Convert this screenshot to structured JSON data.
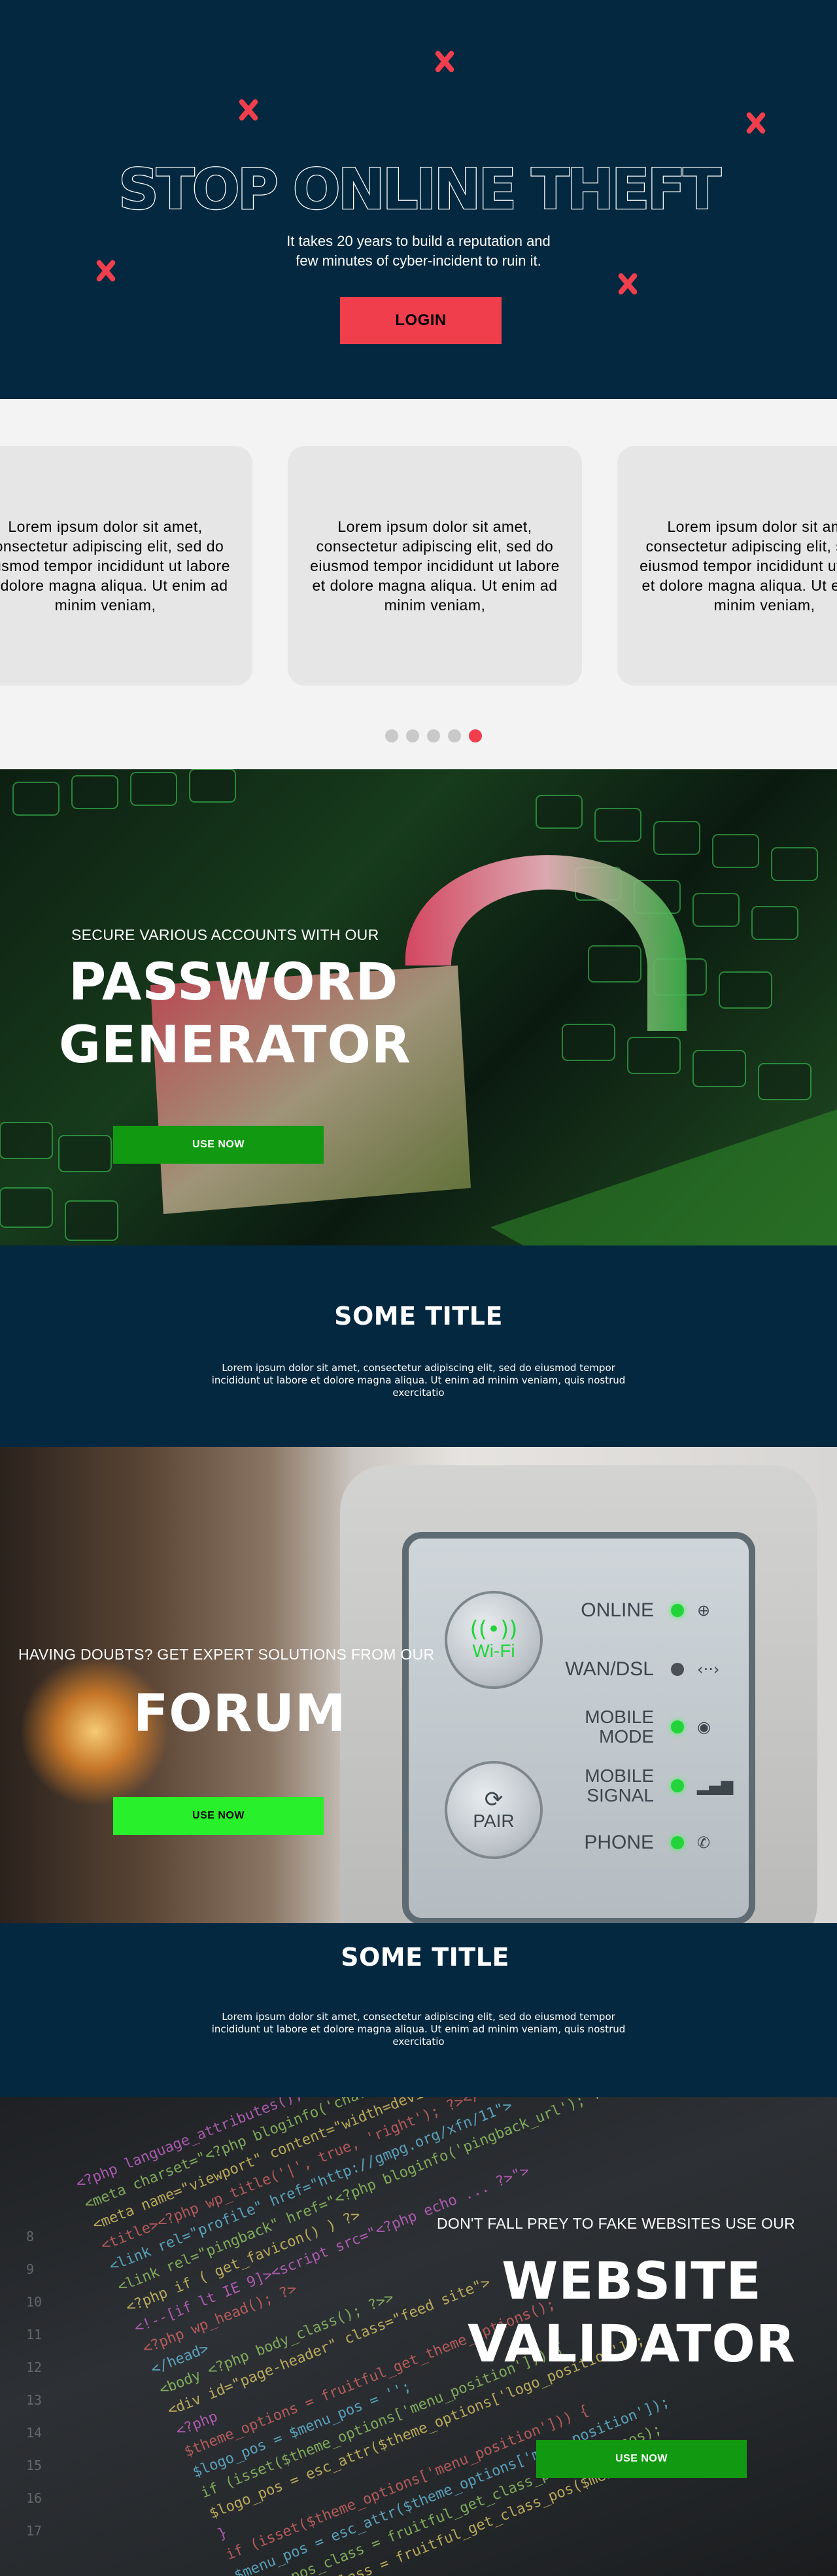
{
  "hero": {
    "title": "STOP ONLINE THEFT",
    "subtitle_line1": "It takes 20 years to build a reputation and",
    "subtitle_line2": "few minutes of cyber-incident to ruin it.",
    "login_label": "LOGIN"
  },
  "carousel": {
    "cards": [
      {
        "text": "Lorem ipsum dolor sit amet, consectetur adipiscing elit, sed do eiusmod tempor incididunt ut labore et dolore magna aliqua. Ut enim ad minim veniam,"
      },
      {
        "text": "Lorem ipsum dolor sit amet, consectetur adipiscing elit, sed do eiusmod tempor incididunt ut labore et dolore magna aliqua. Ut enim ad minim veniam,"
      },
      {
        "text": "Lorem ipsum dolor sit amet, consectetur adipiscing elit, sed do eiusmod tempor incididunt ut labore et dolore magna aliqua. Ut enim ad minim veniam,"
      }
    ],
    "dot_count": 5,
    "active_dot": 5
  },
  "password": {
    "eyebrow": "SECURE VARIOUS ACCOUNTS WITH OUR",
    "title_line1": "PASSWORD",
    "title_line2": "GENERATOR",
    "button_label": "USE NOW"
  },
  "info1": {
    "title": "SOME TITLE",
    "text": "Lorem ipsum dolor sit amet, consectetur adipiscing elit, sed do eiusmod tempor incididunt ut labore et dolore magna aliqua. Ut enim ad minim veniam, quis nostrud exercitatio"
  },
  "forum": {
    "eyebrow": "HAVING DOUBTS? GET EXPERT SOLUTIONS FROM OUR",
    "title": "FORUM",
    "button_label": "USE NOW",
    "router": {
      "wifi_label": "Wi-Fi",
      "pair_label": "PAIR",
      "leds": [
        {
          "label": "ONLINE",
          "on": true
        },
        {
          "label": "WAN/DSL",
          "on": false
        },
        {
          "label": "MOBILE MODE",
          "on": true
        },
        {
          "label": "MOBILE SIGNAL",
          "on": true
        },
        {
          "label": "PHONE",
          "on": true
        }
      ]
    }
  },
  "info2": {
    "title": "SOME TITLE",
    "text": "Lorem ipsum dolor sit amet, consectetur adipiscing elit, sed do eiusmod tempor incididunt ut labore et dolore magna aliqua. Ut enim ad minim veniam, quis nostrud exercitatio"
  },
  "validator": {
    "eyebrow": "DON'T FALL PREY TO FAKE WEBSITES USE OUR",
    "title_line1": "WEBSITE",
    "title_line2": "VALIDATOR",
    "button_label": "USE NOW"
  },
  "colors": {
    "navy": "#03283f",
    "accent_red": "#f13e4d",
    "green_button": "#119a11",
    "lime_button": "#28f02a"
  }
}
